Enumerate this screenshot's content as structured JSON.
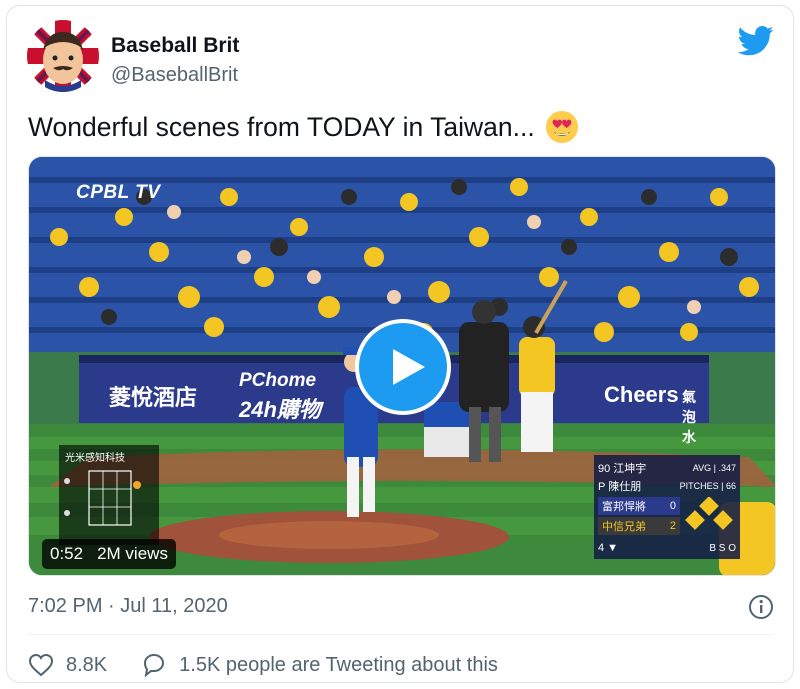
{
  "tweet": {
    "author_name": "Baseball Brit",
    "author_handle": "@BaseballBrit",
    "text": "Wonderful scenes from TODAY in Taiwan...",
    "emoji": "heart-eyes-emoji",
    "timestamp": "7:02 PM · Jul 11, 2020",
    "likes": "8.8K",
    "retweet_text": "1.5K people are Tweeting about this"
  },
  "video": {
    "duration": "0:52",
    "views": "2M views",
    "broadcast_logo": "CPBL TV",
    "banner_hotel": "菱悅酒店",
    "banner_pchome": "PChome",
    "banner_24h": "24h購物",
    "banner_cheers": "Cheers",
    "banner_cheers_sub": "氣泡水",
    "scoreboard": {
      "batter": "90 江坤宇",
      "avg": "AVG | .347",
      "pitcher": "P 陳仕朋",
      "pitches": "PITCHES | 66",
      "team1": "富邦悍將",
      "team1_score": "0",
      "team2": "中信兄弟",
      "team2_score": "2",
      "inning": "4 ▼",
      "count": "B S O"
    },
    "pitch_box_label": "光米感知科技"
  },
  "colors": {
    "twitter_blue": "#1d9bf0",
    "text_primary": "#0f1419",
    "text_secondary": "#536471"
  },
  "icons": {
    "brand": "twitter-bird-icon",
    "like": "heart-outline-icon",
    "reply": "speech-bubble-icon",
    "info": "info-circle-icon",
    "play": "play-icon"
  }
}
